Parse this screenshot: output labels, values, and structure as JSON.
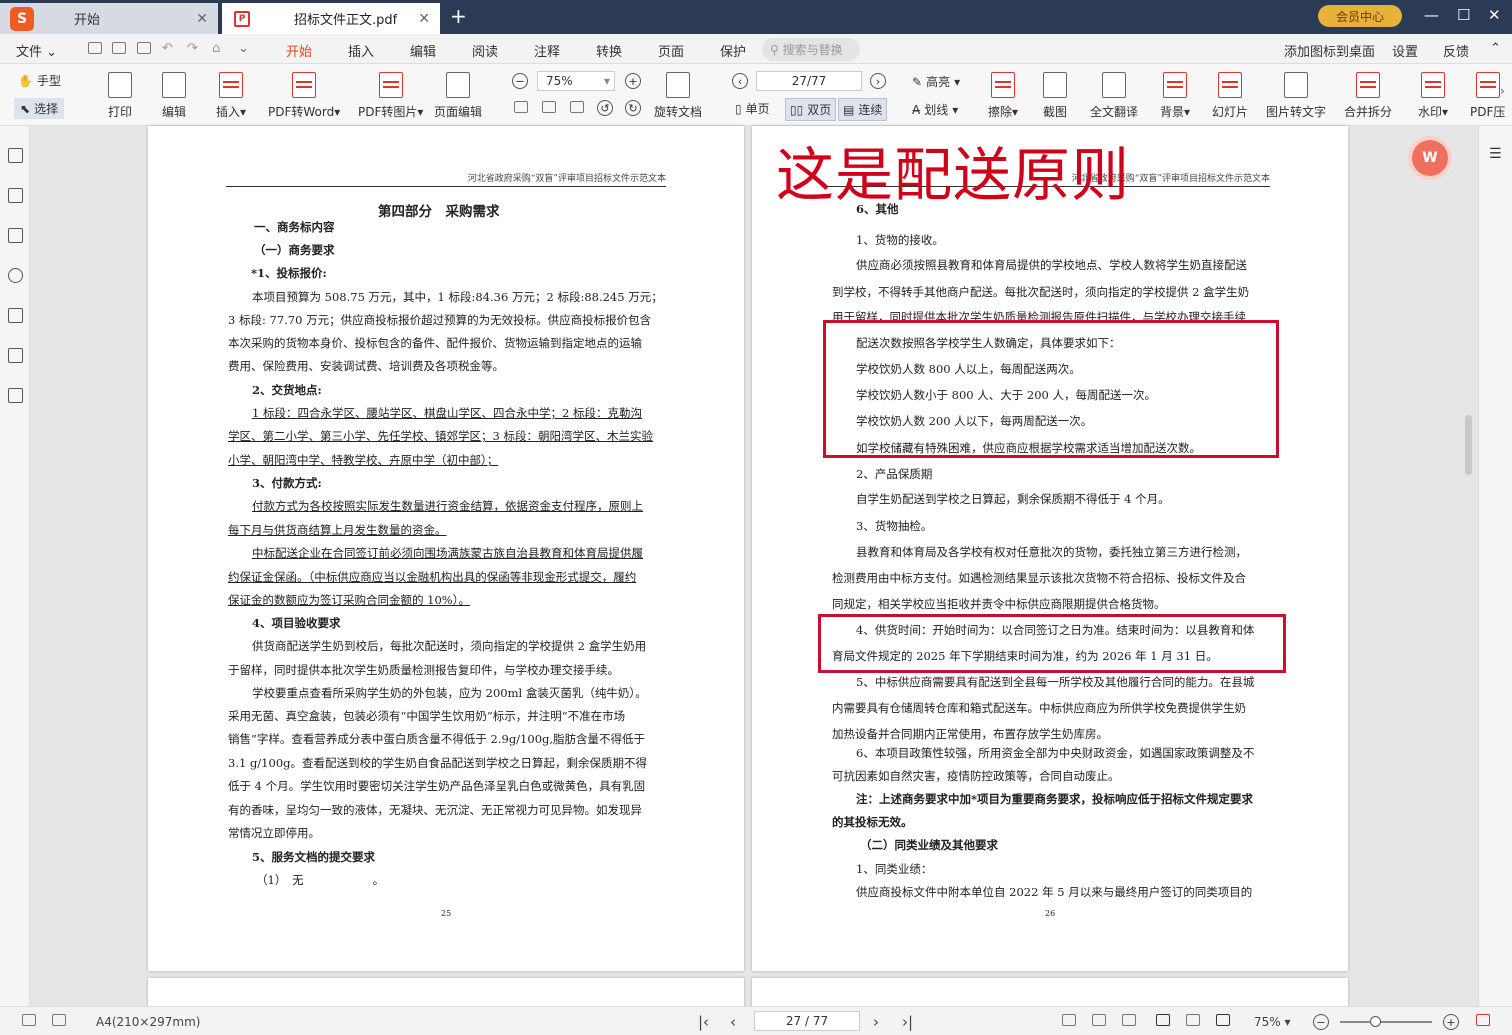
{
  "titlebar": {
    "tab1": "开始",
    "tab2": "招标文件正文.pdf",
    "vip": "会员中心"
  },
  "menu": {
    "file": "文件",
    "items": [
      "开始",
      "插入",
      "编辑",
      "阅读",
      "注释",
      "转换",
      "页面",
      "保护"
    ],
    "search_placeholder": "搜索与替换",
    "right": [
      "添加图标到桌面",
      "设置",
      "反馈"
    ]
  },
  "toolbar": {
    "hand": "手型",
    "select": "选择",
    "buttons": [
      "打印",
      "编辑",
      "插入",
      "PDF转Word",
      "PDF转图片",
      "页面编辑"
    ],
    "zoom": "75%",
    "rotate": "旋转文档",
    "page": "27/77",
    "single": "单页",
    "double": "双页",
    "continuous": "连续",
    "highlight": "高亮",
    "strike": "划线",
    "more": [
      "擦除",
      "截图",
      "全文翻译",
      "背景",
      "幻灯片",
      "图片转文字",
      "合并拆分",
      "水印",
      "PDF压"
    ]
  },
  "overlay_text": "这是配送原则",
  "page_left": {
    "header": "河北省政府采购“双盲”评审项目招标文件示范文本",
    "lines": [
      "第四部分　采购需求",
      "一、商务标内容",
      "（一）商务要求",
      "*1、投标报价:",
      "本项目预算为 508.75 万元，其中，1 标段:84.36 万元；2 标段:88.245 万元；",
      "3 标段: 77.70 万元；供应商投标报价超过预算的为无效投标。供应商投标报价包含",
      "本次采购的货物本身价、投标包含的备件、配件报价、货物运输到指定地点的运输",
      "费用、保险费用、安装调试费、培训费及各项税金等。",
      "2、交货地点:",
      " 1 标段：四合永学区、腰站学区、棋盘山学区、四合永中学；2 标段：克勒沟",
      "学区、第二小学、第三小学、先任学校、镇郊学区；3 标段：朝阳湾学区、木兰实验",
      "小学、朝阳湾中学、特教学校、卉原中学（初中部）；",
      "3、付款方式:",
      "付款方式为各校按照实际发生数量进行资金结算，依据资金支付程序，原则上",
      "每下月与供货商结算上月发生数量的资金。",
      "中标配送企业在合同签订前必须向围场满族蒙古族自治县教育和体育局提供履",
      "约保证金保函。（中标供应商应当以金融机构出具的保函等非现金形式提交，履约",
      "保证金的数额应为签订采购合同金额的 10%）。",
      "4、项目验收要求",
      "供货商配送学生奶到校后，每批次配送时，须向指定的学校提供 2 盒学生奶用",
      "于留样，同时提供本批次学生奶质量检测报告复印件，与学校办理交接手续。",
      "学校要重点查看所采购学生奶的外包装，应为 200ml 盒装灭菌乳（纯牛奶）。",
      "采用无菌、真空盒装，包装必须有“中国学生饮用奶”标示，并注明“不准在市场",
      "销售”字样。查看营养成分表中蛋白质含量不得低于 2.9g/100g,脂肪含量不得低于",
      "3.1 g/100g。查看配送到校的学生奶自食品配送到学校之日算起，剩余保质期不得",
      "低于 4 个月。学生饮用时要密切关注学生奶产品色泽呈乳白色或微黄色，具有乳固",
      "有的香味，呈均匀一致的液体，无凝块、无沉淀、无正常视力可见异物。如发现异",
      "常情况立即停用。",
      "5、服务文档的提交要求",
      "（1）　无　　　　　　。"
    ],
    "page_no": "25"
  },
  "page_right": {
    "header": "河北省政府采购“双盲”评审项目招标文件示范文本",
    "lines": [
      "6、其他",
      "1、货物的接收。",
      "供应商必须按照县教育和体育局提供的学校地点、学校人数将学生奶直接配送",
      "到学校，不得转手其他商户配送。每批次配送时，须向指定的学校提供 2 盒学生奶",
      "用于留样，同时提供本批次学生奶质量检测报告原件扫描件，与学校办理交接手续",
      "配送次数按照各学校学生人数确定，具体要求如下：",
      "学校饮奶人数 800 人以上，每周配送两次。",
      "学校饮奶人数小于 800 人、大于 200 人，每周配送一次。",
      "学校饮奶人数 200 人以下，每两周配送一次。",
      "如学校储藏有特殊困难，供应商应根据学校需求适当增加配送次数。",
      "2、产品保质期",
      "自学生奶配送到学校之日算起，剩余保质期不得低于 4 个月。",
      "3、货物抽检。",
      "县教育和体育局及各学校有权对任意批次的货物，委托独立第三方进行检测，",
      "检测费用由中标方支付。如遇检测结果显示该批次货物不符合招标、投标文件及合",
      "同规定，相关学校应当拒收并责令中标供应商限期提供合格货物。",
      "4、供货时间：开始时间为：以合同签订之日为准。结束时间为：以县教育和体",
      "育局文件规定的 2025 年下学期结束时间为准，约为 2026 年 1 月 31 日。",
      "5、中标供应商需要具有配送到全县每一所学校及其他履行合同的能力。在县城",
      "内需要具有仓储周转仓库和箱式配送车。中标供应商应为所供学校免费提供学生奶",
      "加热设备并合同期内正常使用，布置存放学生奶库房。",
      "6、本项目政策性较强，所用资金全部为中央财政资金，如遇国家政策调整及不",
      "可抗因素如自然灾害，疫情防控政策等，合同自动废止。",
      "注：上述商务要求中加*项目为重要商务要求，投标响应低于招标文件规定要求",
      "的其投标无效。",
      "（二）同类业绩及其他要求",
      "1、同类业绩：",
      "供应商投标文件中附本单位自 2022 年 5 月以来与最终用户签订的同类项目的"
    ],
    "page_no": "26"
  },
  "status": {
    "paper": "A4(210×297mm)",
    "page": "27 / 77",
    "zoom": "75%"
  }
}
